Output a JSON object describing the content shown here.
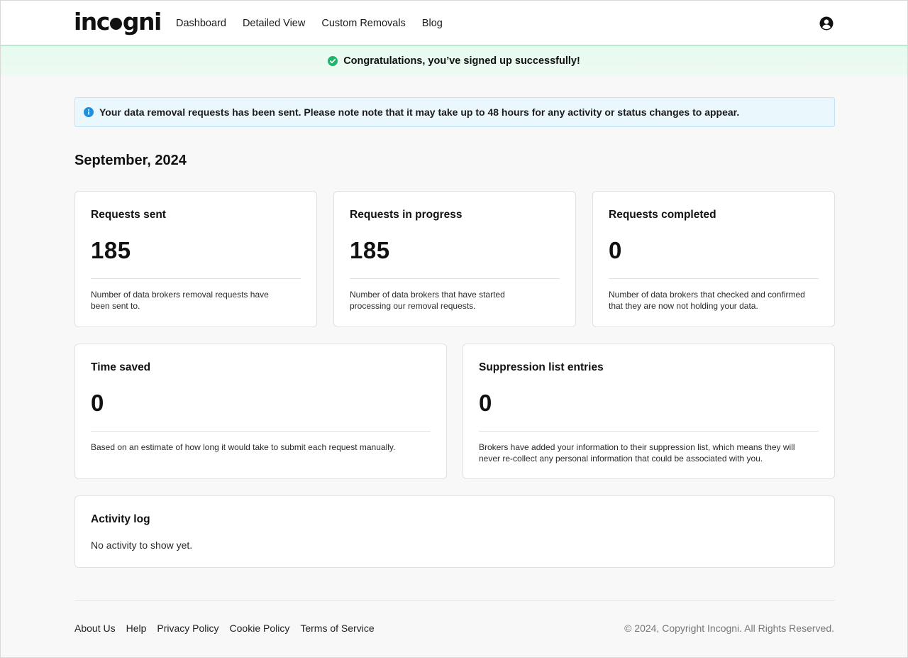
{
  "header": {
    "logo": "incogni",
    "nav": [
      "Dashboard",
      "Detailed View",
      "Custom Removals",
      "Blog"
    ],
    "user_icon": "user-circle-icon"
  },
  "banner": {
    "text": "Congratulations, you’ve signed up successfully!",
    "icon": "check-circle-icon",
    "color": "#1fb36b"
  },
  "info": {
    "text": "Your data removal requests has been sent. Please note note that it may take up to 48 hours for any activity or status changes to appear.",
    "icon": "info-icon",
    "color": "#1e90e0"
  },
  "period": "September, 2024",
  "stats": [
    {
      "title": "Requests sent",
      "value": "185",
      "desc": "Number of data brokers removal requests have been sent to."
    },
    {
      "title": "Requests in progress",
      "value": "185",
      "desc": "Number of data brokers that have started processing our removal requests."
    },
    {
      "title": "Requests completed",
      "value": "0",
      "desc": "Number of data brokers that checked and confirmed that they are now not holding your data."
    },
    {
      "title": "Time saved",
      "value": "0",
      "desc": "Based on an estimate of how long it would take to submit each request manually."
    },
    {
      "title": "Suppression list entries",
      "value": "0",
      "desc": "Brokers have added your information to their suppression list, which means they will never re-collect any personal information that could be associated with you."
    }
  ],
  "activity": {
    "title": "Activity log",
    "empty": "No activity to show yet."
  },
  "footer": {
    "links": [
      "About Us",
      "Help",
      "Privacy Policy",
      "Cookie Policy",
      "Terms of Service"
    ],
    "copyright": "© 2024, Copyright Incogni. All Rights Reserved."
  }
}
